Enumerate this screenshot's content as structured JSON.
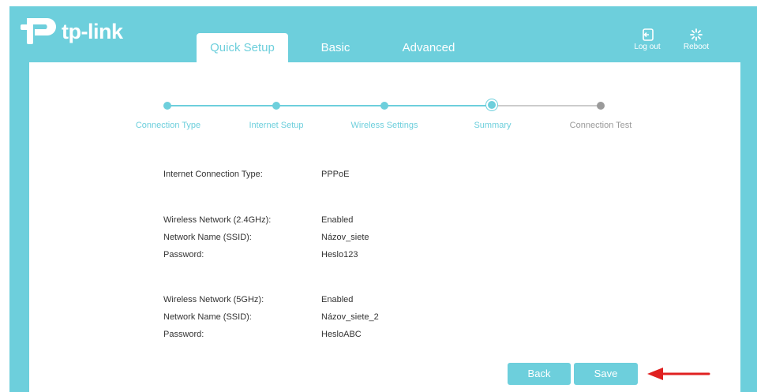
{
  "brand": {
    "logo_text": "tp-link"
  },
  "nav": {
    "tabs": [
      {
        "label": "Quick Setup",
        "active": true
      },
      {
        "label": "Basic",
        "active": false
      },
      {
        "label": "Advanced",
        "active": false
      }
    ],
    "logout_label": "Log out",
    "reboot_label": "Reboot"
  },
  "steps": [
    {
      "label": "Connection Type",
      "state": "done"
    },
    {
      "label": "Internet Setup",
      "state": "done"
    },
    {
      "label": "Wireless Settings",
      "state": "done"
    },
    {
      "label": "Summary",
      "state": "current"
    },
    {
      "label": "Connection Test",
      "state": "upcoming"
    }
  ],
  "summary": {
    "internet": {
      "label": "Internet Connection Type:",
      "value": "PPPoE"
    },
    "wifi24": {
      "status_label": "Wireless Network (2.4GHz):",
      "status_value": "Enabled",
      "ssid_label": "Network Name (SSID):",
      "ssid_value": "Názov_siete",
      "password_label": "Password:",
      "password_value": "Heslo123"
    },
    "wifi5": {
      "status_label": "Wireless Network (5GHz):",
      "status_value": "Enabled",
      "ssid_label": "Network Name (SSID):",
      "ssid_value": "Názov_siete_2",
      "password_label": "Password:",
      "password_value": "HesloABC"
    }
  },
  "buttons": {
    "back_label": "Back",
    "save_label": "Save"
  },
  "colors": {
    "accent": "#6dcfdc",
    "upcoming": "#9a9a9a",
    "annotation_arrow": "#e02020"
  }
}
